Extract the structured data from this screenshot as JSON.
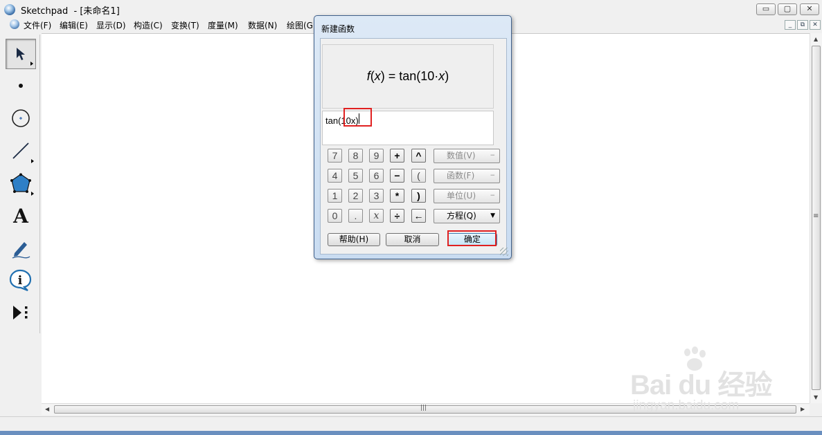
{
  "window": {
    "title": "Sketchpad  - [未命名1]",
    "min_btn": "▭",
    "max_btn": "▢",
    "close_btn": "✕",
    "mdi_min": "_",
    "mdi_restore": "⧉",
    "mdi_close": "✕"
  },
  "menu": [
    {
      "label": "文件(F)"
    },
    {
      "label": "编辑(E)"
    },
    {
      "label": "显示(D)"
    },
    {
      "label": "构造(C)"
    },
    {
      "label": "变换(T)"
    },
    {
      "label": "度量(M)"
    },
    {
      "label": "数据(N)"
    },
    {
      "label": "绘图(G"
    }
  ],
  "toolbox": {
    "tools": [
      {
        "name": "arrow-tool",
        "icon": "arrow-icon",
        "active": true
      },
      {
        "name": "point-tool",
        "icon": "point-icon"
      },
      {
        "name": "compass-tool",
        "icon": "circle-icon"
      },
      {
        "name": "straightedge-tool",
        "icon": "line-icon"
      },
      {
        "name": "polygon-tool",
        "icon": "polygon-icon"
      },
      {
        "name": "text-tool",
        "icon": "text-icon",
        "glyph": "A"
      },
      {
        "name": "marker-tool",
        "icon": "pen-icon"
      },
      {
        "name": "information-tool",
        "icon": "info-icon",
        "glyph": "i"
      },
      {
        "name": "custom-tool",
        "icon": "custom-tool-icon"
      }
    ]
  },
  "dialog": {
    "title": "新建函数",
    "preview": {
      "f": "f",
      "x1": "x",
      "mid": ") = tan(10·",
      "x2": "x",
      "end": ")"
    },
    "expression": "tan(10x)",
    "keypad": {
      "rows": [
        [
          "7",
          "8",
          "9",
          "+",
          "^"
        ],
        [
          "4",
          "5",
          "6",
          "−",
          "("
        ],
        [
          "1",
          "2",
          "3",
          "*",
          ")"
        ],
        [
          "0",
          ".",
          "x",
          "÷",
          "←"
        ]
      ]
    },
    "side_buttons": [
      {
        "label": "数值(V)",
        "suffix": "−",
        "enabled": false
      },
      {
        "label": "函数(F)",
        "suffix": "−",
        "enabled": false
      },
      {
        "label": "单位(U)",
        "suffix": "−",
        "enabled": false
      },
      {
        "label": "方程(Q)",
        "suffix": "▼",
        "enabled": true
      }
    ],
    "buttons": {
      "help": "帮助(H)",
      "cancel": "取消",
      "ok": "确定"
    }
  },
  "scrollbars": {
    "h_grip": "|||",
    "v_grip": "≡"
  },
  "watermark": {
    "main": "Bai  du 经验",
    "sub": "jingyan.baidu.com"
  },
  "colors": {
    "highlight_box": "#e02020",
    "dialog_border": "#3e5f8a",
    "canvas": "#ffffff"
  }
}
